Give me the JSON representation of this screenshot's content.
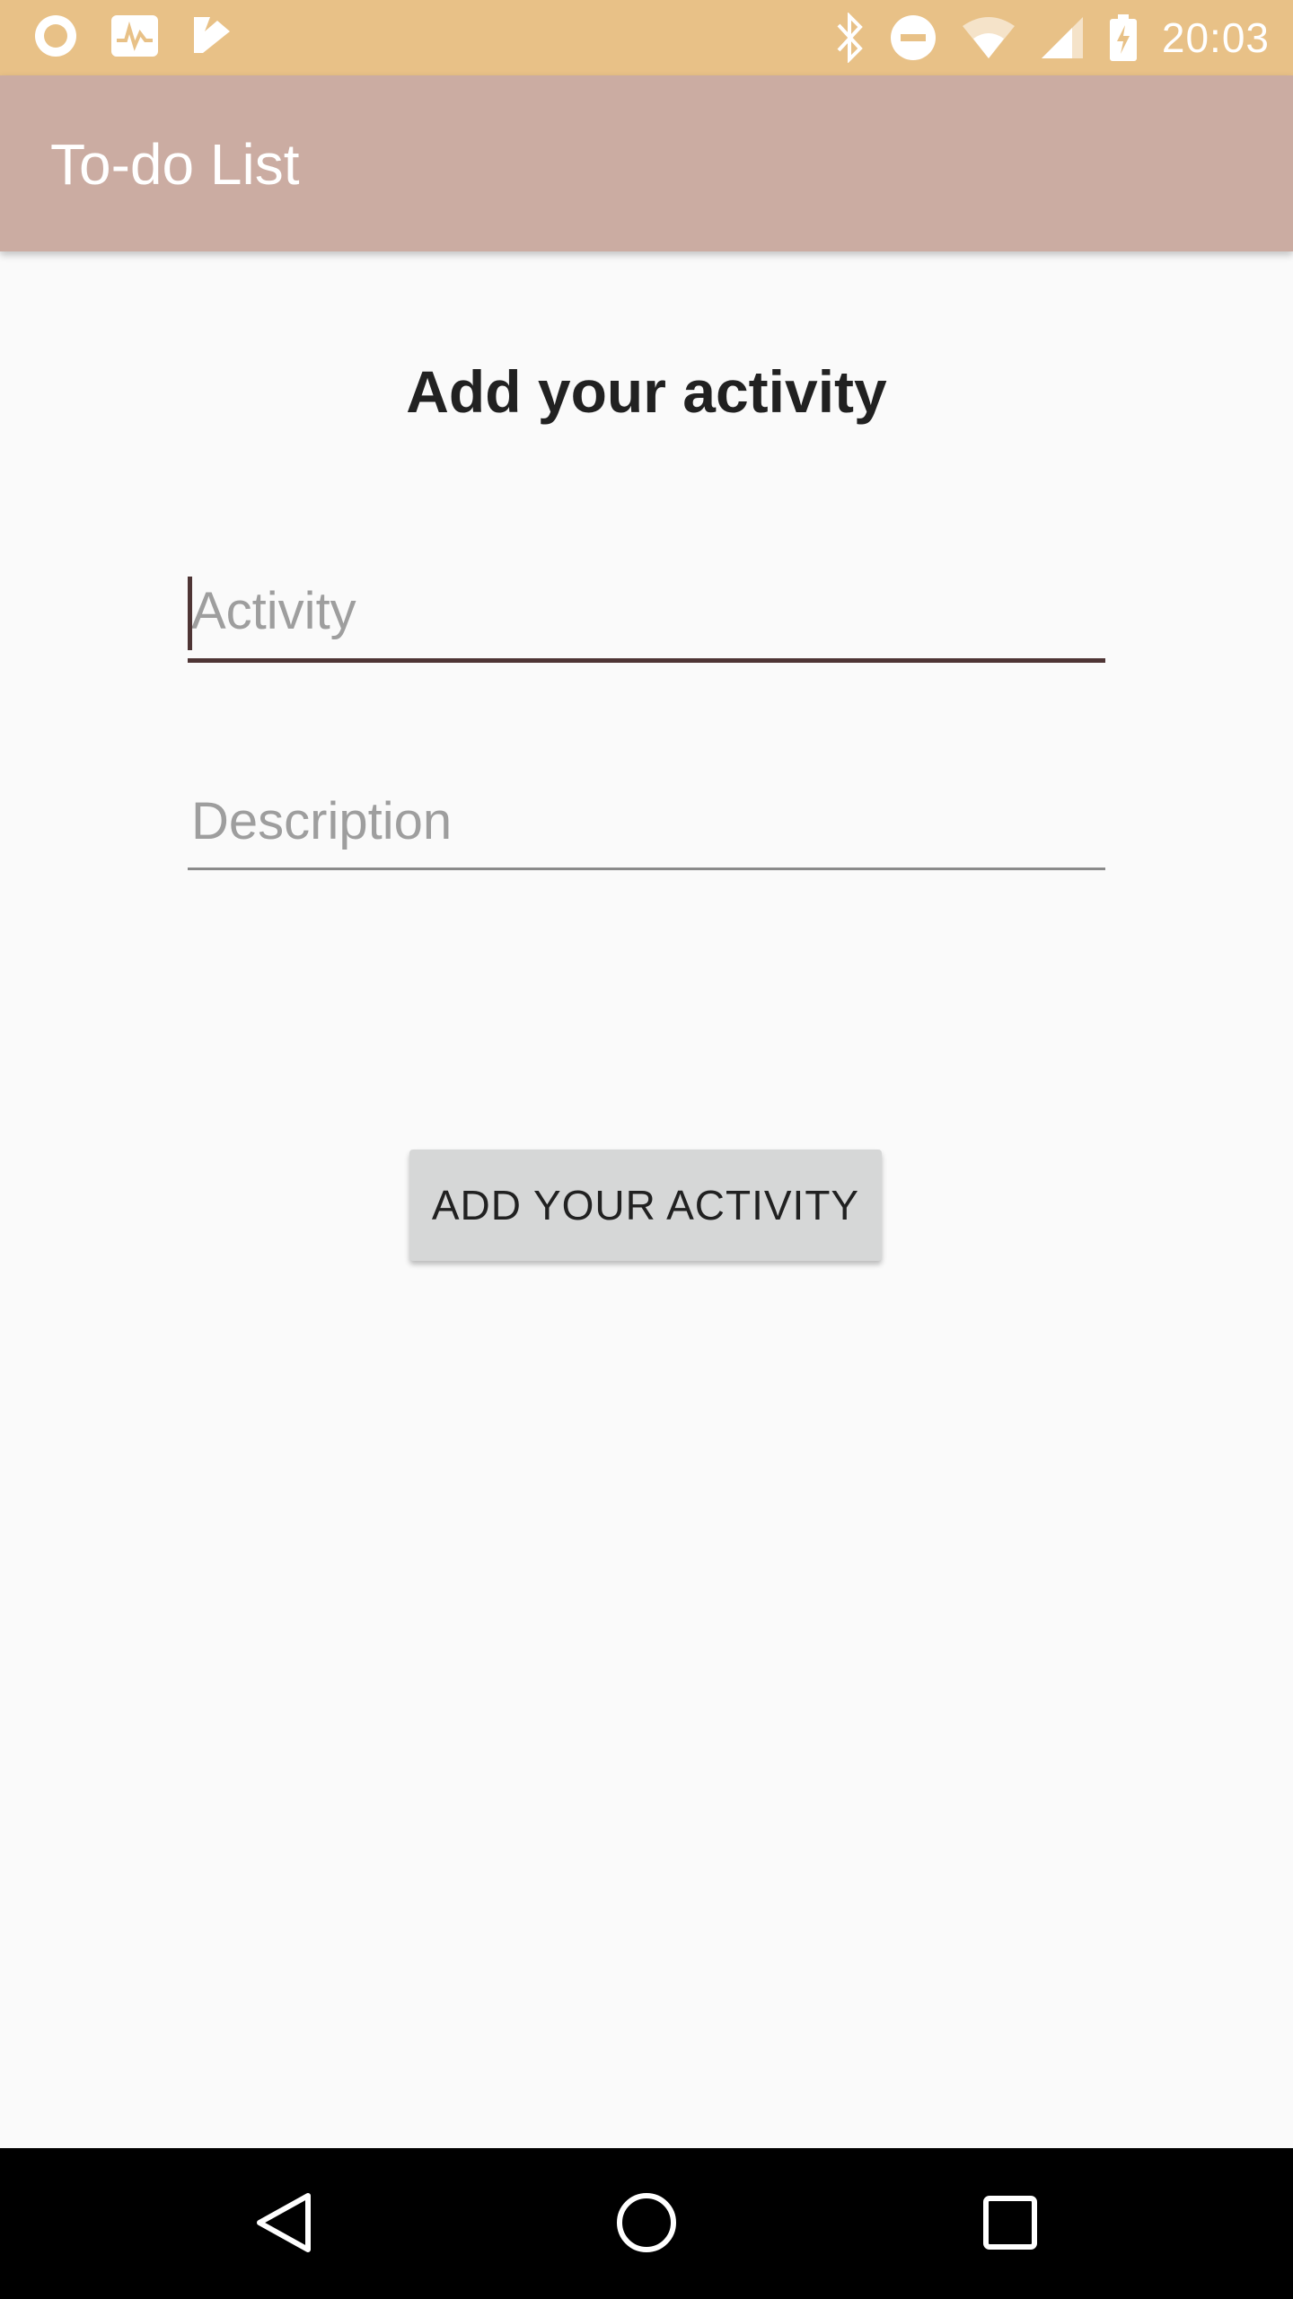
{
  "status_bar": {
    "time": "20:03",
    "left_icons": [
      "record-icon",
      "activity-chart-icon",
      "task-check-icon"
    ],
    "right_icons": [
      "bluetooth-icon",
      "do-not-disturb-icon",
      "wifi-icon",
      "cell-signal-icon",
      "battery-charging-icon"
    ]
  },
  "app_bar": {
    "title": "To-do List"
  },
  "form": {
    "heading": "Add your activity",
    "activity_placeholder": "Activity",
    "description_placeholder": "Description",
    "submit_label": "ADD YOUR ACTIVITY"
  },
  "nav_bar": {
    "buttons": [
      "back-icon",
      "home-icon",
      "recents-icon"
    ]
  },
  "colors": {
    "status_bar": "#e8c187",
    "app_bar": "#cbaca2",
    "accent": "#4e3535",
    "button": "#d6d7d7"
  }
}
